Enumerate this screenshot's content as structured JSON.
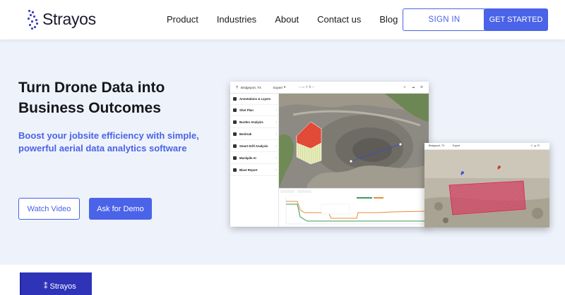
{
  "nav": {
    "brand": "Strayos",
    "links": [
      "Product",
      "Industries",
      "About",
      "Contact us",
      "Blog"
    ],
    "signin_label": "SIGN IN",
    "get_started_label": "GET STARTED"
  },
  "hero": {
    "title_line1": "Turn Drone Data into",
    "title_line2": "Business Outcomes",
    "subtitle_line1": "Boost your jobsite efficiency with simple,",
    "subtitle_line2": "powerful aerial data analytics software",
    "watch_label": "Watch Video",
    "demo_label": "Ask for Demo"
  },
  "app1": {
    "location": "Bridgeport, TX",
    "mode": "Expert",
    "sidebar": [
      "Annotations & Layers",
      "Shot Plan",
      "Burden Analysis",
      "Benitrak",
      "Smart Drill Analysis",
      "Muckpile AI",
      "Blast Report"
    ]
  },
  "app2": {
    "location": "Bridgeport, TX",
    "mode": "Expert"
  },
  "book": {
    "brand": "Strayos"
  },
  "colors": {
    "accent": "#4a63e8",
    "hero_bg": "#eef2fb",
    "book": "#2f33b8"
  }
}
